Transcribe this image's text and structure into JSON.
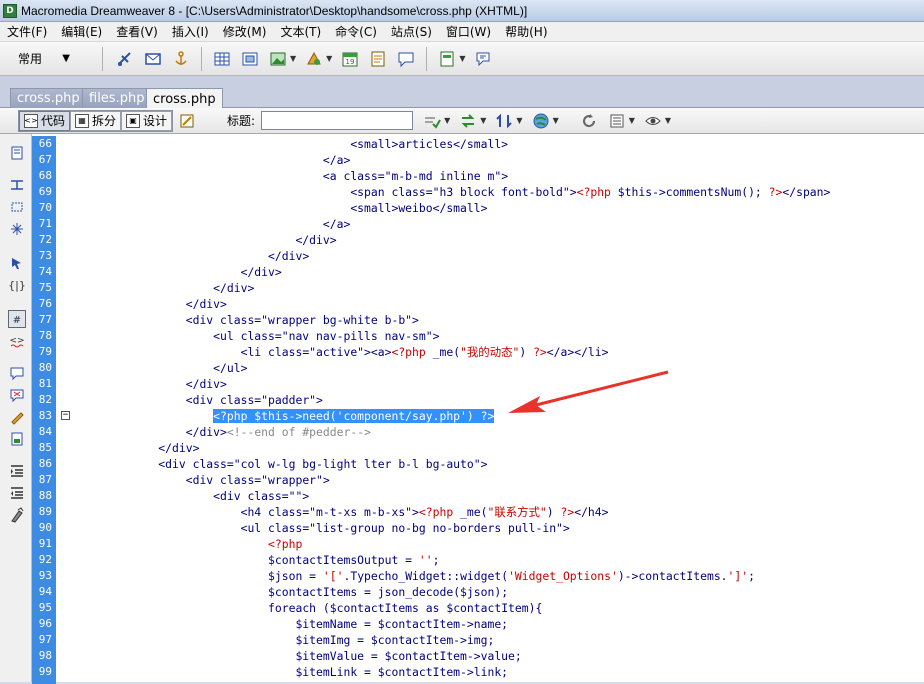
{
  "window": {
    "title": "Macromedia Dreamweaver 8 - [C:\\Users\\Administrator\\Desktop\\handsome\\cross.php (XHTML)]"
  },
  "menu": [
    "文件(F)",
    "编辑(E)",
    "查看(V)",
    "插入(I)",
    "修改(M)",
    "文本(T)",
    "命令(C)",
    "站点(S)",
    "窗口(W)",
    "帮助(H)"
  ],
  "insert_bar": {
    "category": "常用"
  },
  "tabs": [
    "cross.php",
    "files.php",
    "cross.php"
  ],
  "active_tab": 2,
  "doc_toolbar": {
    "code_label": "代码",
    "split_label": "拆分",
    "design_label": "设计",
    "title_label": "标题:",
    "title_value": ""
  },
  "line_numbers": [
    "66",
    "67",
    "68",
    "69",
    "70",
    "71",
    "72",
    "73",
    "74",
    "75",
    "76",
    "77",
    "78",
    "79",
    "80",
    "81",
    "82",
    "83",
    "84",
    "85",
    "86",
    "87",
    "88",
    "89",
    "90",
    "91",
    "92",
    "93",
    "94",
    "95",
    "96",
    "97",
    "98",
    "99"
  ],
  "code_lines": [
    "                        <small>articles</small>",
    "                    </a>",
    "                    <a class=\"m-b-md inline m\">",
    "                        <span class=\"h3 block font-bold\"><?php $this->commentsNum(); ?></span>",
    "                        <small>weibo</small>",
    "                    </a>",
    "                </div>",
    "            </div>",
    "        </div>",
    "    </div>",
    "</div>",
    "<div class=\"wrapper bg-white b-b\">",
    "    <ul class=\"nav nav-pills nav-sm\">",
    "        <li class=\"active\"><a><?php _me(\"我的动态\") ?></a></li>",
    "    </ul>",
    "</div>",
    "<div class=\"padder\">",
    "    <?php $this->need('component/say.php') ?>",
    "</div><!--end of #pedder-->",
    "</div>",
    "<div class=\"col w-lg bg-light lter b-l bg-auto\">",
    "    <div class=\"wrapper\">",
    "        <div class=\"\">",
    "            <h4 class=\"m-t-xs m-b-xs\"><?php _me(\"联系方式\") ?></h4>",
    "            <ul class=\"list-group no-bg no-borders pull-in\">",
    "                <?php",
    "                $contactItemsOutput = '';",
    "                $json = '['.Typecho_Widget::widget('Widget_Options')->contactItems.']';",
    "                $contactItems = json_decode($json);",
    "                foreach ($contactItems as $contactItem){",
    "                    $itemName = $contactItem->name;",
    "                    $itemImg = $contactItem->img;",
    "                    $itemValue = $contactItem->value;",
    "                    $itemLink = $contactItem->link;"
  ],
  "code_indent_base": [
    "                ",
    "                ",
    "                ",
    "                ",
    "                ",
    "                ",
    "                ",
    "                ",
    "                ",
    "                ",
    "                ",
    "                ",
    "                ",
    "                ",
    "                ",
    "                ",
    "                ",
    "                ",
    "                ",
    "            ",
    "            ",
    "            ",
    "            ",
    "            ",
    "            ",
    "            ",
    "            ",
    "            ",
    "            ",
    "            ",
    "            ",
    "            ",
    "            ",
    "            "
  ],
  "selected_line": 17,
  "colors": {
    "selection": "#3390ff",
    "gutter": "#3d8be3",
    "annotation_arrow": "#e8322c"
  }
}
